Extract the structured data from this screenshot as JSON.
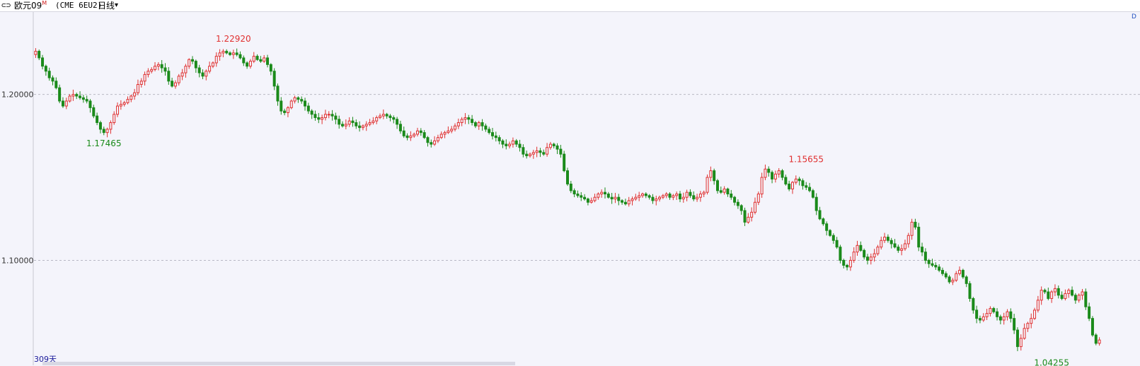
{
  "header": {
    "link_icon": "link-icon",
    "symbol": "欧元09",
    "symbol_sup": "M",
    "code": "(CME 6EU2)",
    "period": "日线",
    "period_dropdown_icon": "chevron-down-icon"
  },
  "day_count_label": "309天",
  "corner_label": "D",
  "colors": {
    "up": "#e03030",
    "down": "#1a8a1a",
    "grid": "#b8b8c4",
    "background": "#f4f4fb"
  },
  "chart_data": {
    "type": "candlestick",
    "ylim": [
      1.03675,
      1.24965
    ],
    "yticks": [
      1.1,
      1.2
    ],
    "ytick_labels": [
      "1.10000",
      "1.20000"
    ],
    "grid": "horizontal-dashed",
    "annotations": [
      {
        "text": "1.22920",
        "index": 58,
        "value": 1.2292,
        "kind": "high"
      },
      {
        "text": "1.17465",
        "index": 20,
        "value": 1.17465,
        "kind": "low"
      },
      {
        "text": "1.15655",
        "index": 226,
        "value": 1.15655,
        "kind": "high"
      },
      {
        "text": "1.04255",
        "index": 298,
        "value": 1.04255,
        "kind": "low"
      }
    ],
    "closes": [
      1.226,
      1.222,
      1.217,
      1.214,
      1.21,
      1.208,
      1.204,
      1.196,
      1.193,
      1.196,
      1.199,
      1.2,
      1.199,
      1.198,
      1.197,
      1.196,
      1.192,
      1.187,
      1.183,
      1.179,
      1.177,
      1.179,
      1.183,
      1.188,
      1.193,
      1.194,
      1.195,
      1.197,
      1.199,
      1.201,
      1.206,
      1.208,
      1.212,
      1.214,
      1.215,
      1.217,
      1.218,
      1.216,
      1.214,
      1.208,
      1.205,
      1.207,
      1.211,
      1.213,
      1.217,
      1.221,
      1.22,
      1.216,
      1.213,
      1.211,
      1.214,
      1.217,
      1.219,
      1.223,
      1.225,
      1.226,
      1.225,
      1.224,
      1.225,
      1.224,
      1.222,
      1.219,
      1.217,
      1.22,
      1.223,
      1.221,
      1.22,
      1.222,
      1.218,
      1.214,
      1.205,
      1.196,
      1.19,
      1.189,
      1.192,
      1.196,
      1.198,
      1.197,
      1.196,
      1.193,
      1.19,
      1.188,
      1.186,
      1.185,
      1.186,
      1.188,
      1.188,
      1.187,
      1.185,
      1.182,
      1.181,
      1.182,
      1.184,
      1.183,
      1.181,
      1.18,
      1.181,
      1.182,
      1.183,
      1.184,
      1.186,
      1.187,
      1.188,
      1.187,
      1.186,
      1.185,
      1.182,
      1.178,
      1.175,
      1.174,
      1.175,
      1.176,
      1.178,
      1.177,
      1.174,
      1.171,
      1.17,
      1.172,
      1.174,
      1.176,
      1.177,
      1.178,
      1.179,
      1.181,
      1.183,
      1.185,
      1.186,
      1.185,
      1.183,
      1.181,
      1.183,
      1.181,
      1.179,
      1.177,
      1.175,
      1.174,
      1.172,
      1.17,
      1.169,
      1.17,
      1.172,
      1.17,
      1.168,
      1.164,
      1.163,
      1.164,
      1.165,
      1.166,
      1.165,
      1.164,
      1.168,
      1.17,
      1.169,
      1.167,
      1.164,
      1.154,
      1.146,
      1.142,
      1.14,
      1.139,
      1.138,
      1.137,
      1.135,
      1.136,
      1.138,
      1.14,
      1.141,
      1.14,
      1.138,
      1.137,
      1.138,
      1.136,
      1.135,
      1.134,
      1.136,
      1.137,
      1.138,
      1.139,
      1.14,
      1.139,
      1.138,
      1.136,
      1.137,
      1.138,
      1.139,
      1.14,
      1.138,
      1.139,
      1.14,
      1.137,
      1.138,
      1.141,
      1.139,
      1.137,
      1.138,
      1.14,
      1.141,
      1.15,
      1.154,
      1.148,
      1.142,
      1.141,
      1.143,
      1.14,
      1.138,
      1.135,
      1.133,
      1.13,
      1.123,
      1.126,
      1.129,
      1.135,
      1.14,
      1.15,
      1.155,
      1.153,
      1.149,
      1.152,
      1.154,
      1.15,
      1.146,
      1.143,
      1.147,
      1.149,
      1.148,
      1.145,
      1.144,
      1.142,
      1.138,
      1.13,
      1.125,
      1.122,
      1.118,
      1.115,
      1.112,
      1.108,
      1.1,
      1.097,
      1.096,
      1.1,
      1.105,
      1.109,
      1.106,
      1.102,
      1.1,
      1.102,
      1.104,
      1.108,
      1.112,
      1.114,
      1.112,
      1.11,
      1.108,
      1.106,
      1.107,
      1.11,
      1.115,
      1.123,
      1.12,
      1.108,
      1.105,
      1.1,
      1.098,
      1.097,
      1.096,
      1.094,
      1.092,
      1.09,
      1.087,
      1.088,
      1.092,
      1.094,
      1.09,
      1.086,
      1.077,
      1.07,
      1.065,
      1.064,
      1.066,
      1.068,
      1.071,
      1.069,
      1.066,
      1.064,
      1.066,
      1.069,
      1.065,
      1.058,
      1.048,
      1.053,
      1.059,
      1.062,
      1.065,
      1.07,
      1.076,
      1.082,
      1.081,
      1.077,
      1.081,
      1.083,
      1.079,
      1.077,
      1.08,
      1.082,
      1.079,
      1.076,
      1.079,
      1.081,
      1.072,
      1.065,
      1.055,
      1.05,
      1.052
    ]
  }
}
